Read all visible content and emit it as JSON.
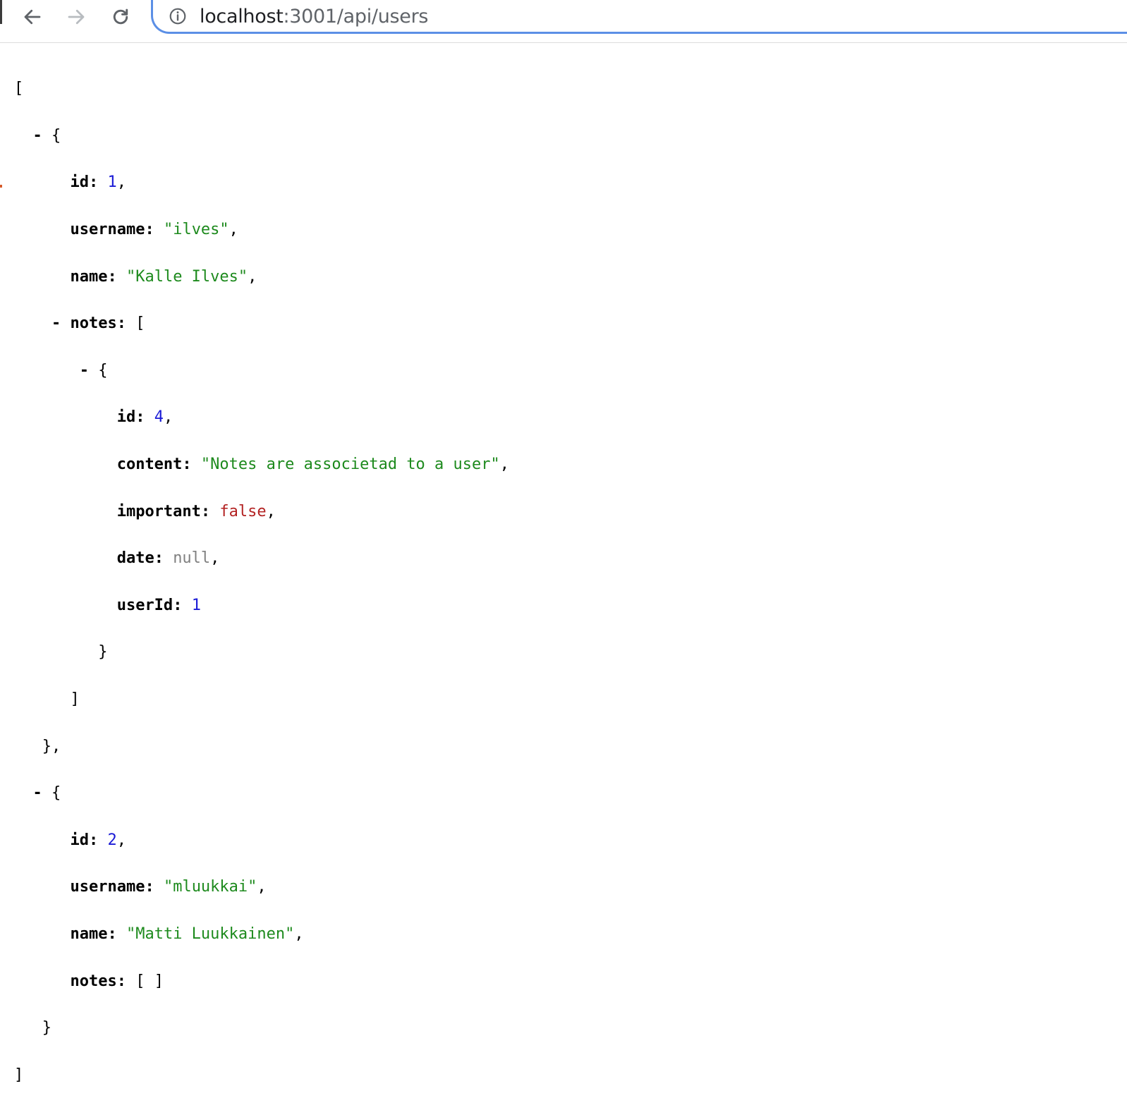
{
  "browser": {
    "url_host": "localhost",
    "url_rest": ":3001/api/users",
    "icons": {
      "back": "arrow-left-icon",
      "forward": "arrow-right-icon",
      "reload": "reload-icon",
      "info": "info-icon"
    }
  },
  "json": {
    "users": [
      {
        "id": "1",
        "username": "\"ilves\"",
        "name": "\"Kalle Ilves\"",
        "notes": [
          {
            "id": "4",
            "content": "\"Notes are associetad to a user\"",
            "important": "false",
            "date": "null",
            "userId": "1"
          }
        ]
      },
      {
        "id": "2",
        "username": "\"mluukkai\"",
        "name": "\"Matti Luukkainen\"",
        "notes_empty": "[ ]"
      }
    ],
    "keys": {
      "id": "id",
      "username": "username",
      "name": "name",
      "notes": "notes",
      "content": "content",
      "important": "important",
      "date": "date",
      "userId": "userId"
    },
    "toggle": "-"
  }
}
